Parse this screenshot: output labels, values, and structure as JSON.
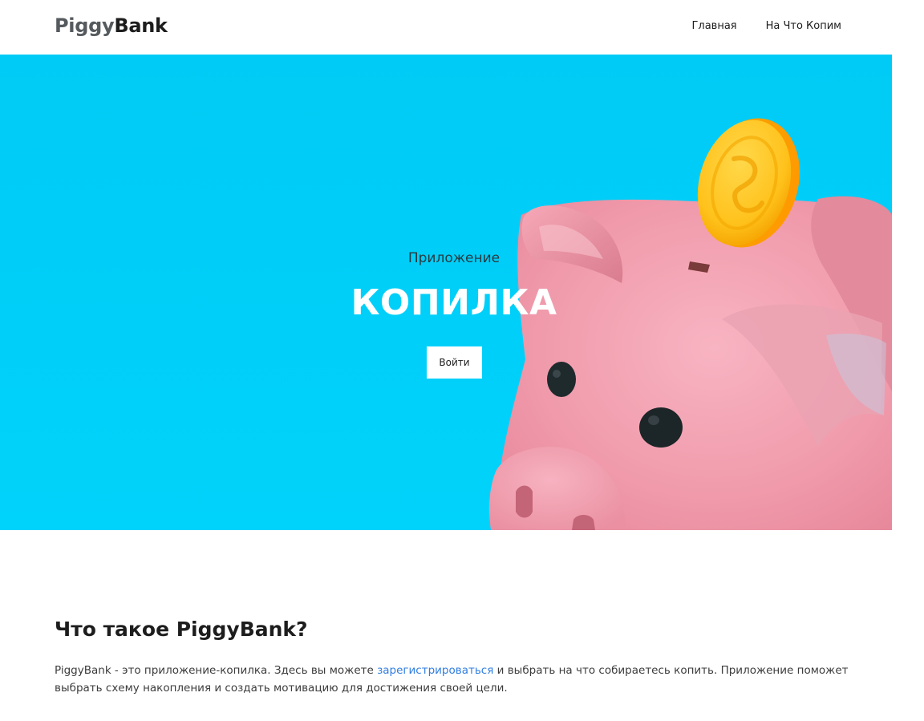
{
  "header": {
    "logo_part1": "Piggy",
    "logo_part2": "Bank",
    "nav": [
      {
        "label": "Главная"
      },
      {
        "label": "На Что Копим"
      }
    ]
  },
  "hero": {
    "subtitle": "Приложение",
    "title": "КОПИЛКА",
    "button_label": "Войти",
    "background_color": "#00d0f8",
    "illustration": "piggy-bank-with-gold-coin"
  },
  "about": {
    "title": "Что такое PiggyBank?",
    "text_before_link": "PiggyBank - это приложение-копилка. Здесь вы можете ",
    "link_text": "зарегистрироваться",
    "text_after_link": " и выбрать на что собираетесь копить. Приложение поможет выбрать схему накопления и создать мотивацию для достижения своей цели.",
    "link_color": "#2f7de1"
  }
}
